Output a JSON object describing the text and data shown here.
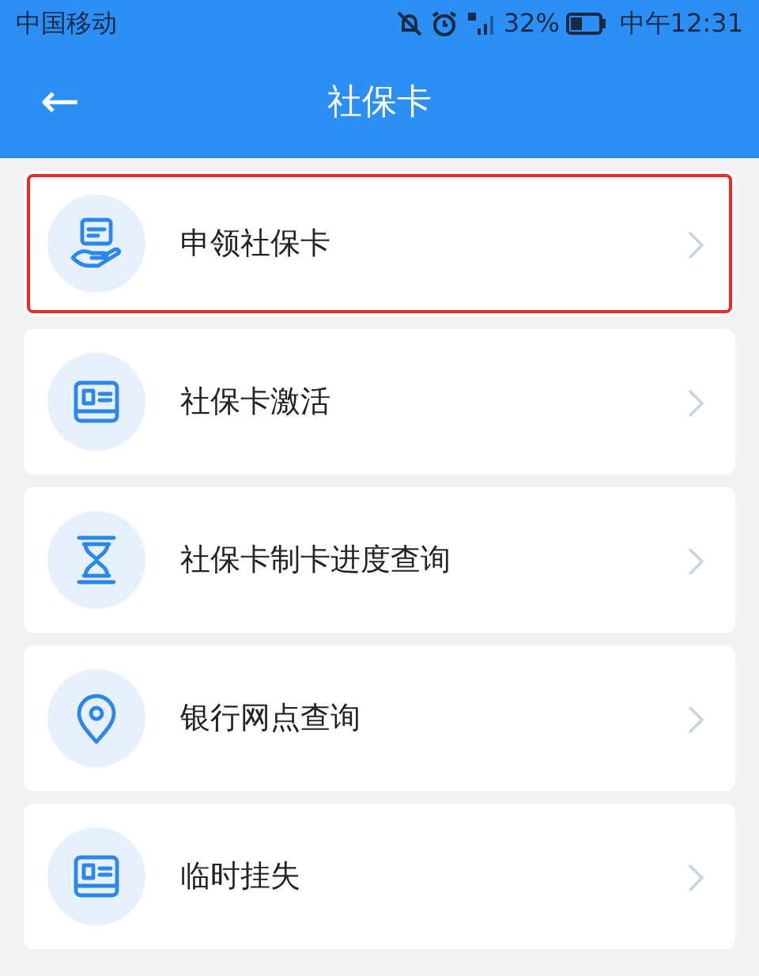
{
  "status_bar": {
    "carrier": "中国移动",
    "battery_percent": "32%",
    "time": "中午12:31"
  },
  "header": {
    "back": "←",
    "title": "社保卡"
  },
  "items": [
    {
      "label": "申领社保卡",
      "kind": "hand-card",
      "highlighted": true
    },
    {
      "label": "社保卡激活",
      "kind": "card",
      "highlighted": false
    },
    {
      "label": "社保卡制卡进度查询",
      "kind": "hourglass",
      "highlighted": false
    },
    {
      "label": "银行网点查询",
      "kind": "pin",
      "highlighted": false
    },
    {
      "label": "临时挂失",
      "kind": "card",
      "highlighted": false
    }
  ]
}
